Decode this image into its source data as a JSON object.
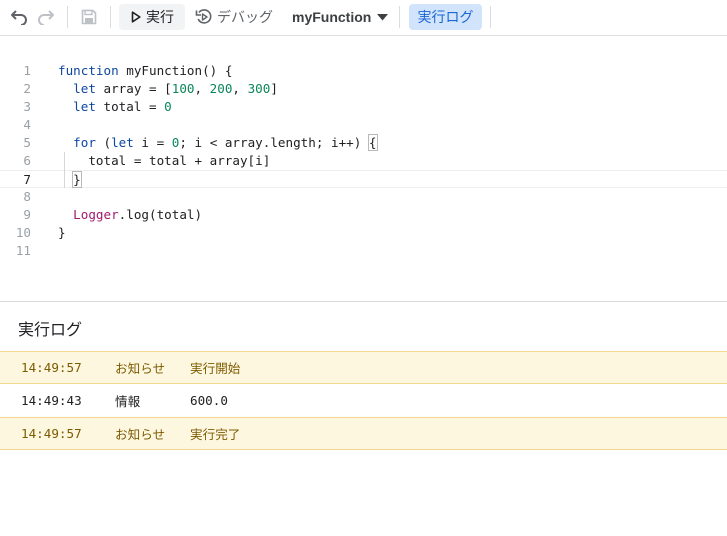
{
  "toolbar": {
    "run_label": "実行",
    "debug_label": "デバッグ",
    "function_name": "myFunction",
    "log_label": "実行ログ",
    "icons": [
      "undo-icon",
      "redo-icon",
      "save-icon",
      "play-icon",
      "debug-icon",
      "caret-down-icon"
    ]
  },
  "editor": {
    "line_numbers": [
      "1",
      "2",
      "3",
      "4",
      "5",
      "6",
      "7",
      "8",
      "9",
      "10",
      "11"
    ],
    "active_line": "7",
    "lines": [
      [
        {
          "t": "function",
          "c": "kw"
        },
        {
          "t": " myFunction() {",
          "c": "fn"
        }
      ],
      [
        {
          "t": "  "
        },
        {
          "t": "let",
          "c": "kw"
        },
        {
          "t": " array = ["
        },
        {
          "t": "100",
          "c": "num"
        },
        {
          "t": ", "
        },
        {
          "t": "200",
          "c": "num"
        },
        {
          "t": ", "
        },
        {
          "t": "300",
          "c": "num"
        },
        {
          "t": "]"
        }
      ],
      [
        {
          "t": "  "
        },
        {
          "t": "let",
          "c": "kw"
        },
        {
          "t": " total = "
        },
        {
          "t": "0",
          "c": "num"
        }
      ],
      [],
      [
        {
          "t": "  "
        },
        {
          "t": "for",
          "c": "kw"
        },
        {
          "t": " ("
        },
        {
          "t": "let",
          "c": "kw"
        },
        {
          "t": " i = "
        },
        {
          "t": "0",
          "c": "num"
        },
        {
          "t": "; i < array.length; i++) "
        },
        {
          "t": "{",
          "c": "brace"
        }
      ],
      [
        {
          "t": "    total = total + array[i]"
        }
      ],
      [
        {
          "t": "  "
        },
        {
          "t": "}",
          "c": "brace"
        }
      ],
      [],
      [
        {
          "t": "  "
        },
        {
          "t": "Logger",
          "c": "obj"
        },
        {
          "t": ".log(total)"
        }
      ],
      [
        {
          "t": "}"
        }
      ],
      []
    ]
  },
  "log": {
    "title": "実行ログ",
    "rows": [
      {
        "time": "14:49:57",
        "level": "お知らせ",
        "message": "実行開始",
        "kind": "notice"
      },
      {
        "time": "14:49:43",
        "level": "情報",
        "message": "600.0",
        "kind": "info"
      },
      {
        "time": "14:49:57",
        "level": "お知らせ",
        "message": "実行完了",
        "kind": "notice"
      }
    ]
  },
  "colors": {
    "keyword": "#0d47a1",
    "number": "#098658",
    "object": "#a11a6e",
    "notice_bg": "#fef7e0",
    "notice_text": "#7c5b00",
    "accent_bg": "#d2e3fc",
    "accent_text": "#1967d2"
  }
}
